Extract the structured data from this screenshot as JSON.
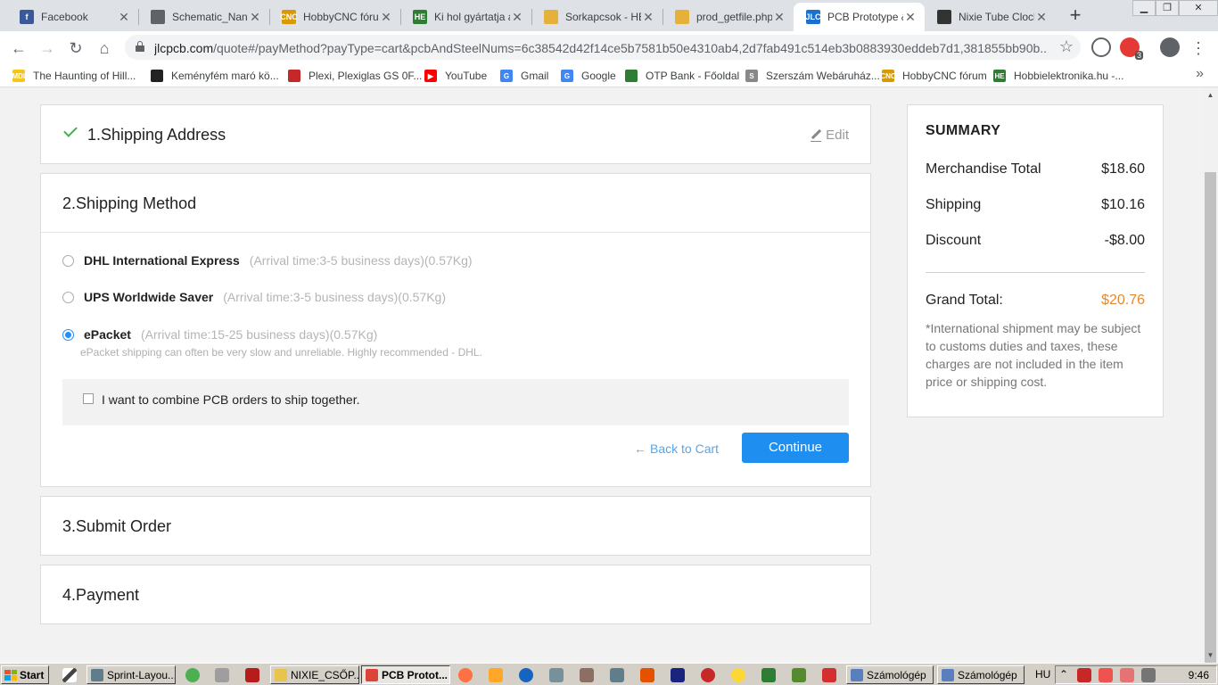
{
  "browser": {
    "tabs": [
      {
        "title": "Facebook",
        "favicon": "facebook-icon",
        "color": "#3b5998",
        "glyph": "f",
        "active": false
      },
      {
        "title": "Schematic_Nano",
        "favicon": "globe-icon",
        "color": "#5f6368",
        "glyph": "",
        "active": false
      },
      {
        "title": "HobbyCNC fórum",
        "favicon": "hobbycnc-icon",
        "color": "#d89a00",
        "glyph": "CNC",
        "active": false
      },
      {
        "title": "Ki hol gyártatja a",
        "favicon": "he-icon",
        "color": "#2e7d32",
        "glyph": "HE",
        "active": false
      },
      {
        "title": "Sorkapcsok - HE",
        "favicon": "he-diamond-icon",
        "color": "#e5b13a",
        "glyph": "",
        "active": false
      },
      {
        "title": "prod_getfile.php",
        "favicon": "he-diamond-icon",
        "color": "#e5b13a",
        "glyph": "",
        "active": false
      },
      {
        "title": "PCB Prototype &",
        "favicon": "jlc-icon",
        "color": "#1a6fd1",
        "glyph": "JLC",
        "active": true
      },
      {
        "title": "Nixie Tube Clock",
        "favicon": "nixie-icon",
        "color": "#333333",
        "glyph": "",
        "active": false
      }
    ],
    "url_host": "jlcpcb.com",
    "url_path": "/quote#/payMethod?payType=cart&pcbAndSteelNums=6c38542d42f14ce5b7581b50e4310ab4,2d7fab491c514eb3b0883930eddeb7d1,381855bb90b...",
    "extension_badge": "3",
    "bookmarks": [
      {
        "label": "The Haunting of Hill...",
        "icon": "imdb-icon",
        "color": "#f5c518",
        "glyph": "IMDb"
      },
      {
        "label": "Keményfém maró kö...",
        "icon": "tool-icon",
        "color": "#222222",
        "glyph": ""
      },
      {
        "label": "Plexi, Plexiglas GS 0F...",
        "icon": "plexi-icon",
        "color": "#c62828",
        "glyph": ""
      },
      {
        "label": "YouTube",
        "icon": "youtube-icon",
        "color": "#ff0000",
        "glyph": "▶"
      },
      {
        "label": "Gmail",
        "icon": "google-icon",
        "color": "#4285f4",
        "glyph": "G"
      },
      {
        "label": "Google",
        "icon": "google-icon",
        "color": "#4285f4",
        "glyph": "G"
      },
      {
        "label": "OTP Bank - Főoldal",
        "icon": "otp-icon",
        "color": "#2e7d32",
        "glyph": ""
      },
      {
        "label": "Szerszám Webáruház...",
        "icon": "shop-icon",
        "color": "#888888",
        "glyph": "S"
      },
      {
        "label": "HobbyCNC fórum",
        "icon": "hobbycnc-icon",
        "color": "#d89a00",
        "glyph": "CNC"
      },
      {
        "label": "Hobbielektronika.hu -...",
        "icon": "he-icon",
        "color": "#2e7d32",
        "glyph": "HE"
      }
    ]
  },
  "checkout": {
    "step1": {
      "title": "1.Shipping Address",
      "edit_label": "Edit"
    },
    "step2": {
      "title": "2.Shipping Method",
      "options": [
        {
          "name": "DHL International Express",
          "info": "(Arrival time:3-5 business days)(0.57Kg)",
          "selected": false
        },
        {
          "name": "UPS Worldwide Saver",
          "info": "(Arrival time:3-5 business days)(0.57Kg)",
          "selected": false
        },
        {
          "name": "ePacket",
          "info": "(Arrival time:15-25 business days)(0.57Kg)",
          "selected": true
        }
      ],
      "note": "ePacket shipping can often be very slow and unreliable. Highly recommended - DHL.",
      "combine_label": "I want to combine PCB orders to ship together.",
      "combine_checked": false,
      "back_label": "Back to Cart",
      "continue_label": "Continue"
    },
    "step3": {
      "title": "3.Submit Order"
    },
    "step4": {
      "title": "4.Payment"
    }
  },
  "summary": {
    "title": "SUMMARY",
    "merchandise_label": "Merchandise Total",
    "merchandise_value": "$18.60",
    "shipping_label": "Shipping",
    "shipping_value": "$10.16",
    "discount_label": "Discount",
    "discount_value": "-$8.00",
    "grand_label": "Grand Total:",
    "grand_value": "$20.76",
    "disclaimer": "*International shipment may be subject to customs duties and taxes, these charges are not included in the item price or shipping cost."
  },
  "taskbar": {
    "start_label": "Start",
    "buttons": [
      {
        "label": "Sprint-Layou...",
        "icon": "sprint-layout-icon",
        "color": "#607d8b",
        "pressed": false
      },
      {
        "label": "NIXIE_CSŐP...",
        "icon": "folder-icon",
        "color": "#e8c44a",
        "pressed": false
      },
      {
        "label": "PCB Protot...",
        "icon": "chrome-icon",
        "color": "#db4437",
        "pressed": true
      },
      {
        "label": "Számológép",
        "icon": "calculator-icon",
        "color": "#5a7fbf",
        "pressed": false
      },
      {
        "label": "Számológép",
        "icon": "calculator-icon",
        "color": "#5a7fbf",
        "pressed": false
      }
    ],
    "language": "HU",
    "clock": "9:46"
  }
}
